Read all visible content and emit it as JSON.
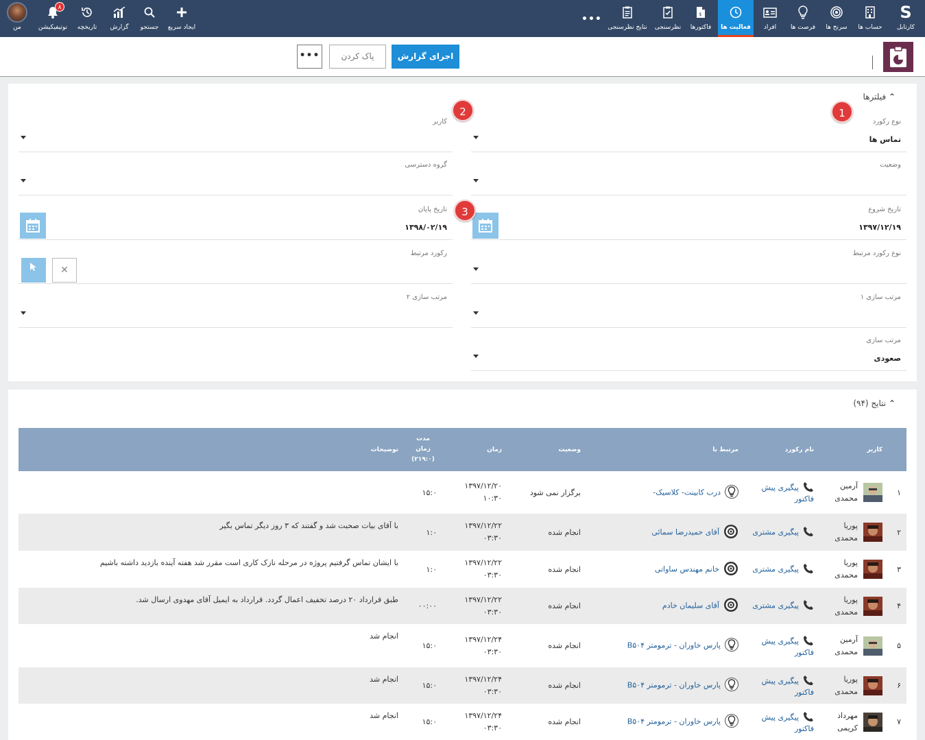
{
  "topnav": {
    "items": [
      {
        "label": "کارتابل",
        "icon": "sarv-logo-icon"
      },
      {
        "label": "حساب ها",
        "icon": "building-icon"
      },
      {
        "label": "سرنخ ها",
        "icon": "target-icon"
      },
      {
        "label": "فرصت ها",
        "icon": "lightbulb-icon"
      },
      {
        "label": "افراد",
        "icon": "id-card-icon"
      },
      {
        "label": "فعالیت ها",
        "icon": "clock-icon"
      },
      {
        "label": "فاکتورها",
        "icon": "invoice-icon"
      },
      {
        "label": "نظرسنجی",
        "icon": "survey-icon"
      },
      {
        "label": "نتایج نظرسنجی",
        "icon": "clipboard-icon"
      }
    ],
    "more": "•••",
    "left_items": [
      {
        "label": "ایجاد سریع",
        "icon": "plus-icon"
      },
      {
        "label": "جستجو",
        "icon": "search-icon"
      },
      {
        "label": "گزارش",
        "icon": "chart-icon"
      },
      {
        "label": "تاریخچه",
        "icon": "history-icon"
      },
      {
        "label": "نوتیفیکیشن",
        "icon": "bell-icon",
        "badge": "۸"
      },
      {
        "label": "من",
        "icon": "avatar"
      }
    ]
  },
  "actions": {
    "run": "اجرای گزارش",
    "clear": "پاک کردن",
    "more": "•••"
  },
  "filters": {
    "title": "فیلترها",
    "record_type": {
      "label": "نوع رکورد",
      "value": "تماس ها"
    },
    "user": {
      "label": "کاربر",
      "value": ""
    },
    "status": {
      "label": "وضعیت",
      "value": ""
    },
    "access_group": {
      "label": "گروه دسترسی",
      "value": ""
    },
    "start_date": {
      "label": "تاریخ شروع",
      "value": "۱۳۹۷/۱۲/۱۹"
    },
    "end_date": {
      "label": "تاریخ پایان",
      "value": "۱۳۹۸/۰۲/۱۹"
    },
    "related_type": {
      "label": "نوع رکورد مرتبط",
      "value": ""
    },
    "related": {
      "label": "رکورد مرتبط",
      "value": ""
    },
    "sort1": {
      "label": "مرتب سازی ۱",
      "value": ""
    },
    "sort2": {
      "label": "مرتب سازی ۲",
      "value": ""
    },
    "sort_dir": {
      "label": "مرتب سازی",
      "value": "صعودی"
    }
  },
  "markers": [
    "1",
    "2",
    "3"
  ],
  "results": {
    "title": "نتایج (۹۴)",
    "columns": [
      "کاربر",
      "نام رکورد",
      "مرتبط با",
      "وضعیت",
      "زمان",
      "مدت زمان (۲۱۹:۰)",
      "توضیحات"
    ],
    "rows": [
      {
        "n": "۱",
        "user": "آرمین محمدی",
        "record": "پیگیری پیش فاکتور",
        "related": "درب کابینت- کلاسیک-",
        "rel_icon": "lightbulb",
        "status": "برگزار نمی شود",
        "time": "۱۳۹۷/۱۲/۲۰ ۱۰:۳۰",
        "dur": "۱۵:۰",
        "desc": "",
        "ava": "a"
      },
      {
        "n": "۲",
        "user": "پوریا محمدی",
        "record": "پیگیری مشتری",
        "related": "آقای حمیدرضا سمائی",
        "rel_icon": "target",
        "status": "انجام شده",
        "time": "۱۳۹۷/۱۲/۲۲ ۰۳:۳۰",
        "dur": "۱:۰",
        "desc": "با آقای بیات صحبت شد و گفتند که ۳ روز دیگر تماس بگیر",
        "ava": "p"
      },
      {
        "n": "۳",
        "user": "پوریا محمدی",
        "record": "پیگیری مشتری",
        "related": "خانم مهندس ساواتی",
        "rel_icon": "target",
        "status": "انجام شده",
        "time": "۱۳۹۷/۱۲/۲۲ ۰۳:۳۰",
        "dur": "۱:۰",
        "desc": "با ایشان تماس گرفتیم پروژه در مرحله نازک کاری است مقرر شد هفته آینده بازدید داشته باشیم",
        "ava": "p"
      },
      {
        "n": "۴",
        "user": "پوریا محمدی",
        "record": "پیگیری مشتری",
        "related": "آقای سلیمان خادم",
        "rel_icon": "target",
        "status": "انجام شده",
        "time": "۱۳۹۷/۱۲/۲۲ ۰۳:۳۰",
        "dur": "۰۰:۰۰",
        "desc": "طبق قرارداد ۲۰ درصد تخفیف اعمال گردد. قرارداد به ایمیل آقای مهدوی ارسال شد.",
        "ava": "p"
      },
      {
        "n": "۵",
        "user": "آرمین محمدی",
        "record": "پیگیری پیش فاکتور",
        "related": "پارس خاوران - ترمومتر B۵۰۴",
        "rel_icon": "lightbulb",
        "status": "انجام شده",
        "time": "۱۳۹۷/۱۲/۲۴ ۰۳:۳۰",
        "dur": "۱۵:۰",
        "desc": "انجام شد",
        "ava": "a"
      },
      {
        "n": "۶",
        "user": "پوریا محمدی",
        "record": "پیگیری پیش فاکتور",
        "related": "پارس خاوران - ترمومتر B۵۰۴",
        "rel_icon": "lightbulb",
        "status": "انجام شده",
        "time": "۱۳۹۷/۱۲/۲۴ ۰۳:۳۰",
        "dur": "۱۵:۰",
        "desc": "انجام شد",
        "ava": "p"
      },
      {
        "n": "۷",
        "user": "مهرداد کریمی",
        "record": "پیگیری پیش فاکتور",
        "related": "پارس خاوران - ترمومتر B۵۰۴",
        "rel_icon": "lightbulb",
        "status": "انجام شده",
        "time": "۱۳۹۷/۱۲/۲۴ ۰۳:۳۰",
        "dur": "۱۵:۰",
        "desc": "انجام شد",
        "ava": "m"
      }
    ]
  },
  "colors": {
    "nav": "#324765",
    "active": "#1a8fdc",
    "run": "#1d8ed7",
    "header": "#8aa4c1",
    "marker": "#e03a3a",
    "app": "#6b2d4e"
  }
}
